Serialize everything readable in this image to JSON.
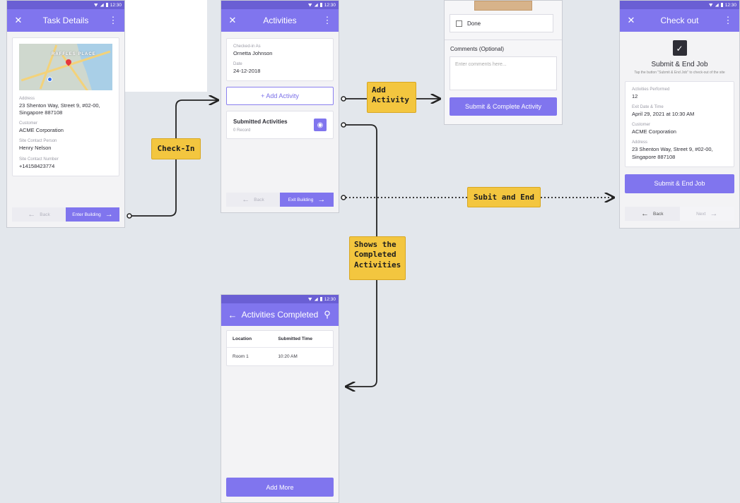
{
  "colors": {
    "primary": "#8075ee",
    "status_bar": "#6a5fd4",
    "background": "#e3e7ec",
    "note": "#f3c63f"
  },
  "status_time": "12:30",
  "task_details": {
    "title": "Task Details",
    "map_district": "RAFFLES PLACE",
    "address_label": "Address",
    "address": "23 Shenton Way, Street 9, #02-00, Singapore 887108",
    "customer_label": "Customer",
    "customer": "ACME Corporation",
    "contact_label": "Site Contact Person",
    "contact": "Henry Nelson",
    "number_label": "Site Contact Number",
    "number": "+14158423774",
    "back": "Back",
    "enter": "Enter Building"
  },
  "activities": {
    "title": "Activities",
    "checked_in_label": "Checked-in As",
    "checked_in": "Ornetta Johnson",
    "date_label": "Date",
    "date": "24-12-2018",
    "add_activity": "+ Add Activity",
    "submitted_title": "Submitted Activities",
    "submitted_count": "0 Record",
    "back": "Back",
    "exit": "Exit Building"
  },
  "activity_form": {
    "done_label": "Done",
    "comments_label": "Comments (Optional)",
    "comments_placeholder": "Enter comments here...",
    "submit": "Submit & Complete Activity"
  },
  "checkout": {
    "title": "Check out",
    "heading": "Submit & End Job",
    "subtitle": "Tap the button \"Submit & End Job\" to check-out of the site",
    "performed_label": "Activities Performed",
    "performed": "12",
    "exit_label": "Exit Date & Time",
    "exit": "April 29, 2021 at 10:30 AM",
    "customer_label": "Customer",
    "customer": "ACME Corporation",
    "address_label": "Address",
    "address": "23 Shenton Way, Street 9, #02-00, Singapore 887108",
    "submit": "Submit & End Job",
    "back": "Back",
    "next": "Next"
  },
  "completed": {
    "title": "Activities Completed",
    "col_location": "Location",
    "col_time": "Submitted Time",
    "rows": [
      {
        "location": "Room 1",
        "time": "10:20 AM"
      }
    ],
    "add_more": "Add More"
  },
  "notes": {
    "check_in": "Check-In",
    "add_activity": "Add\nActivity",
    "submit_end": "Subit and End",
    "shows_completed": "Shows the\nCompleted\nActivities"
  }
}
